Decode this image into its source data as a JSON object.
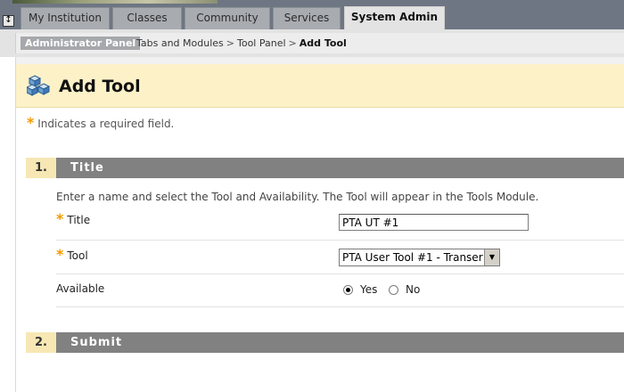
{
  "tabs": [
    {
      "label": "My Institution",
      "active": false
    },
    {
      "label": "Classes",
      "active": false
    },
    {
      "label": "Community",
      "active": false
    },
    {
      "label": "Services",
      "active": false
    },
    {
      "label": "System Admin",
      "active": true
    }
  ],
  "breadcrumb": {
    "badge": "Administrator Panel",
    "items": [
      "Tabs and Modules",
      "Tool Panel",
      "Add Tool"
    ],
    "separator": ">"
  },
  "page": {
    "title": "Add Tool",
    "required_note": "Indicates a required field."
  },
  "steps": [
    {
      "number": "1.",
      "label": "Title"
    },
    {
      "number": "2.",
      "label": "Submit"
    }
  ],
  "form": {
    "instructions": "Enter a name and select the Tool and Availability. The Tool will appear in the Tools Module.",
    "title_label": "Title",
    "title_value": "PTA UT #1",
    "tool_label": "Tool",
    "tool_selected": "PTA User Tool #1 - Transer",
    "available_label": "Available",
    "available_options": [
      "Yes",
      "No"
    ],
    "available_selected": "Yes"
  },
  "colors": {
    "accent_star": "#f29a00",
    "header_bg": "#fdf1c8",
    "step_bar": "#818181",
    "tabbar_bg": "#6e7683"
  }
}
